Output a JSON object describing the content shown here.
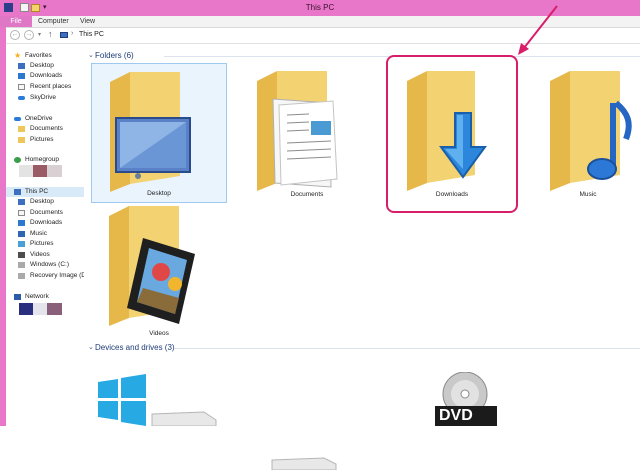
{
  "window": {
    "title": "This PC"
  },
  "ribbon": {
    "tabs": [
      "File",
      "Computer",
      "View"
    ]
  },
  "address": {
    "crumb": "This PC"
  },
  "nav": {
    "favorites": "Favorites",
    "favorite_items": [
      "Desktop",
      "Downloads",
      "Recent places",
      "SkyDrive"
    ],
    "onedrive": "OneDrive",
    "onedrive_items": [
      "Documents",
      "Pictures"
    ],
    "homegroup": "Homegroup",
    "thispc": "This PC",
    "thispc_items": [
      "Desktop",
      "Documents",
      "Downloads",
      "Music",
      "Pictures",
      "Videos",
      "Windows (C:)",
      "Recovery Image (D:)"
    ],
    "network": "Network"
  },
  "content": {
    "folders_header": "Folders (6)",
    "folders": [
      "Desktop",
      "Documents",
      "Downloads",
      "Music",
      "Videos"
    ],
    "devices_header": "Devices and drives (3)",
    "dvd_label": "DVD"
  },
  "colors": {
    "window_frame": "#e977c9",
    "highlight": "#d81e6b",
    "header_text": "#1e3c78"
  }
}
